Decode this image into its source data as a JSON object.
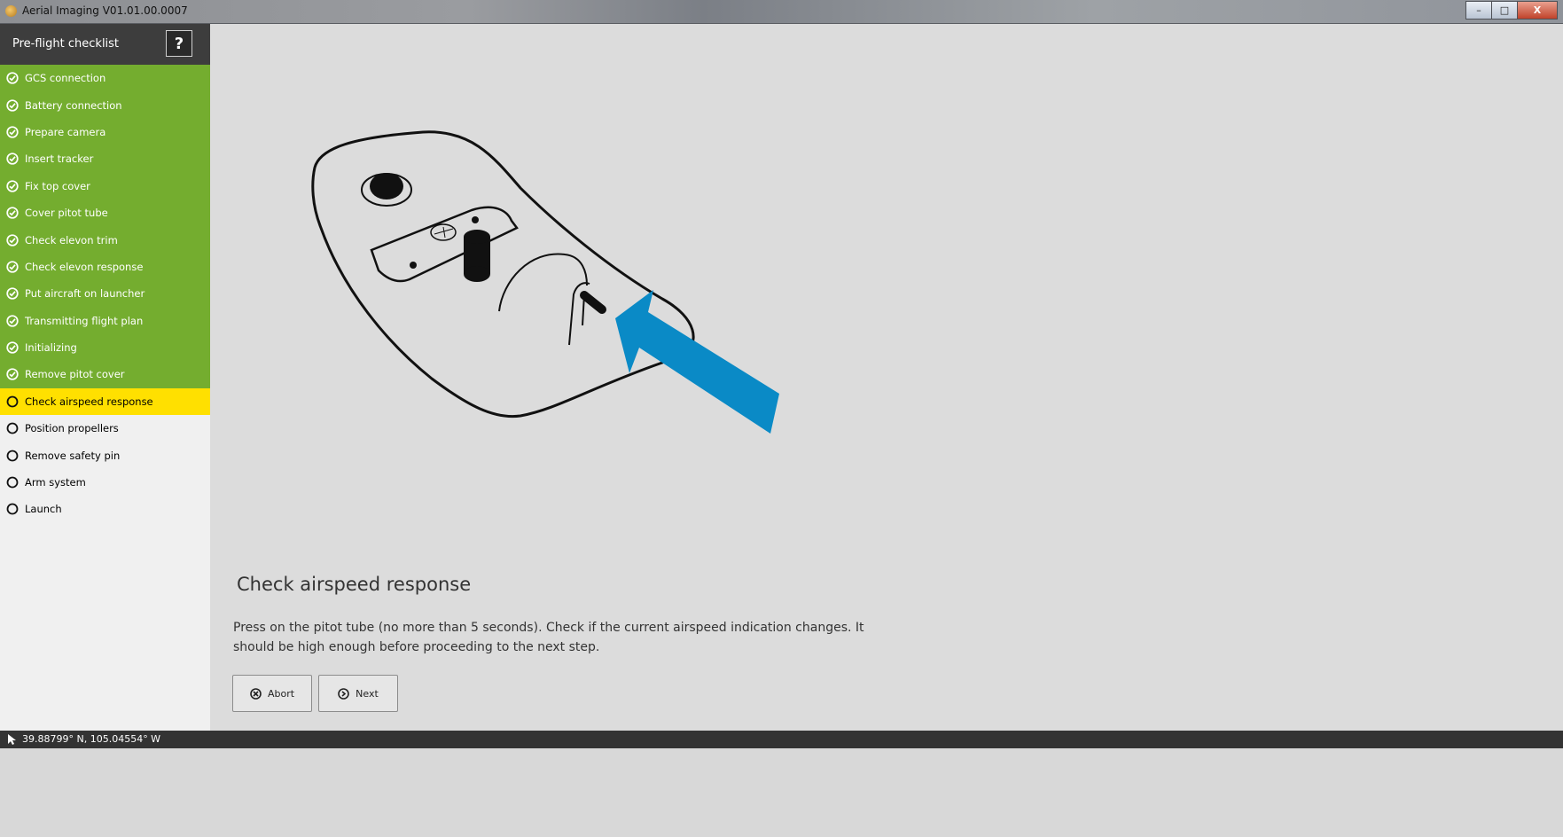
{
  "window": {
    "title": "Aerial Imaging V01.01.00.0007",
    "controls": {
      "minimize": "–",
      "maximize": "□",
      "close": "X"
    }
  },
  "sidebar": {
    "title": "Pre-flight checklist",
    "help_label": "?",
    "steps": [
      {
        "label": "GCS connection",
        "status": "done"
      },
      {
        "label": "Battery connection",
        "status": "done"
      },
      {
        "label": "Prepare camera",
        "status": "done"
      },
      {
        "label": "Insert tracker",
        "status": "done"
      },
      {
        "label": "Fix top cover",
        "status": "done"
      },
      {
        "label": "Cover pitot tube",
        "status": "done"
      },
      {
        "label": "Check elevon trim",
        "status": "done"
      },
      {
        "label": "Check elevon response",
        "status": "done"
      },
      {
        "label": "Put aircraft on launcher",
        "status": "done"
      },
      {
        "label": "Transmitting flight plan",
        "status": "done"
      },
      {
        "label": "Initializing",
        "status": "done"
      },
      {
        "label": "Remove pitot cover",
        "status": "done"
      },
      {
        "label": "Check airspeed response",
        "status": "active"
      },
      {
        "label": "Position propellers",
        "status": "pending"
      },
      {
        "label": "Remove safety pin",
        "status": "pending"
      },
      {
        "label": "Arm system",
        "status": "pending"
      },
      {
        "label": "Launch",
        "status": "pending"
      }
    ]
  },
  "main": {
    "heading": "Check airspeed response",
    "description": "Press on the pitot tube (no more than 5 seconds). Check if the current airspeed indication changes. It should be high enough before proceeding to the next step.",
    "abort_label": "Abort",
    "next_label": "Next"
  },
  "statusbar": {
    "coordinates": "39.88799° N, 105.04554° W"
  },
  "colors": {
    "done": "#74ad2f",
    "active": "#ffe000",
    "arrow": "#0a8ac6",
    "sidebar_header": "#3d3d3d"
  }
}
